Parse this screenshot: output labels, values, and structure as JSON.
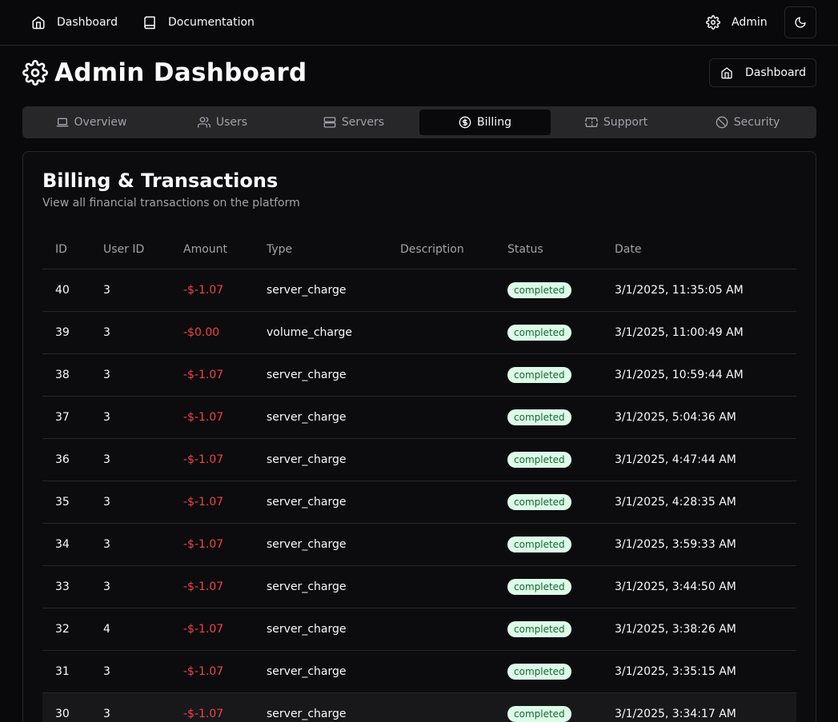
{
  "nav": {
    "dashboard": "Dashboard",
    "documentation": "Documentation",
    "admin": "Admin"
  },
  "page": {
    "title": "Admin Dashboard",
    "dashboard_button": "Dashboard"
  },
  "tabs": [
    {
      "label": "Overview",
      "icon": "laptop-icon"
    },
    {
      "label": "Users",
      "icon": "users-icon"
    },
    {
      "label": "Servers",
      "icon": "server-icon"
    },
    {
      "label": "Billing",
      "icon": "dollar-circle-icon",
      "active": true
    },
    {
      "label": "Support",
      "icon": "ticket-icon"
    },
    {
      "label": "Security",
      "icon": "ban-icon"
    }
  ],
  "card": {
    "title": "Billing & Transactions",
    "description": "View all financial transactions on the platform"
  },
  "table": {
    "columns": [
      "ID",
      "User ID",
      "Amount",
      "Type",
      "Description",
      "Status",
      "Date"
    ],
    "rows": [
      [
        "40",
        "3",
        "-$-1.07",
        "server_charge",
        "",
        "completed",
        "3/1/2025, 11:35:05 AM"
      ],
      [
        "39",
        "3",
        "-$0.00",
        "volume_charge",
        "",
        "completed",
        "3/1/2025, 11:00:49 AM"
      ],
      [
        "38",
        "3",
        "-$-1.07",
        "server_charge",
        "",
        "completed",
        "3/1/2025, 10:59:44 AM"
      ],
      [
        "37",
        "3",
        "-$-1.07",
        "server_charge",
        "",
        "completed",
        "3/1/2025, 5:04:36 AM"
      ],
      [
        "36",
        "3",
        "-$-1.07",
        "server_charge",
        "",
        "completed",
        "3/1/2025, 4:47:44 AM"
      ],
      [
        "35",
        "3",
        "-$-1.07",
        "server_charge",
        "",
        "completed",
        "3/1/2025, 4:28:35 AM"
      ],
      [
        "34",
        "3",
        "-$-1.07",
        "server_charge",
        "",
        "completed",
        "3/1/2025, 3:59:33 AM"
      ],
      [
        "33",
        "3",
        "-$-1.07",
        "server_charge",
        "",
        "completed",
        "3/1/2025, 3:44:50 AM"
      ],
      [
        "32",
        "4",
        "-$-1.07",
        "server_charge",
        "",
        "completed",
        "3/1/2025, 3:38:26 AM"
      ],
      [
        "31",
        "3",
        "-$-1.07",
        "server_charge",
        "",
        "completed",
        "3/1/2025, 3:35:15 AM"
      ],
      [
        "30",
        "3",
        "-$-1.07",
        "server_charge",
        "",
        "completed",
        "3/1/2025, 3:34:17 AM"
      ]
    ]
  },
  "colors": {
    "background": "#09090b",
    "border": "#27272a",
    "muted_text": "#a1a1aa",
    "negative_amount": "#ef4444",
    "badge_bg": "#dcfce7",
    "badge_text": "#166534"
  }
}
